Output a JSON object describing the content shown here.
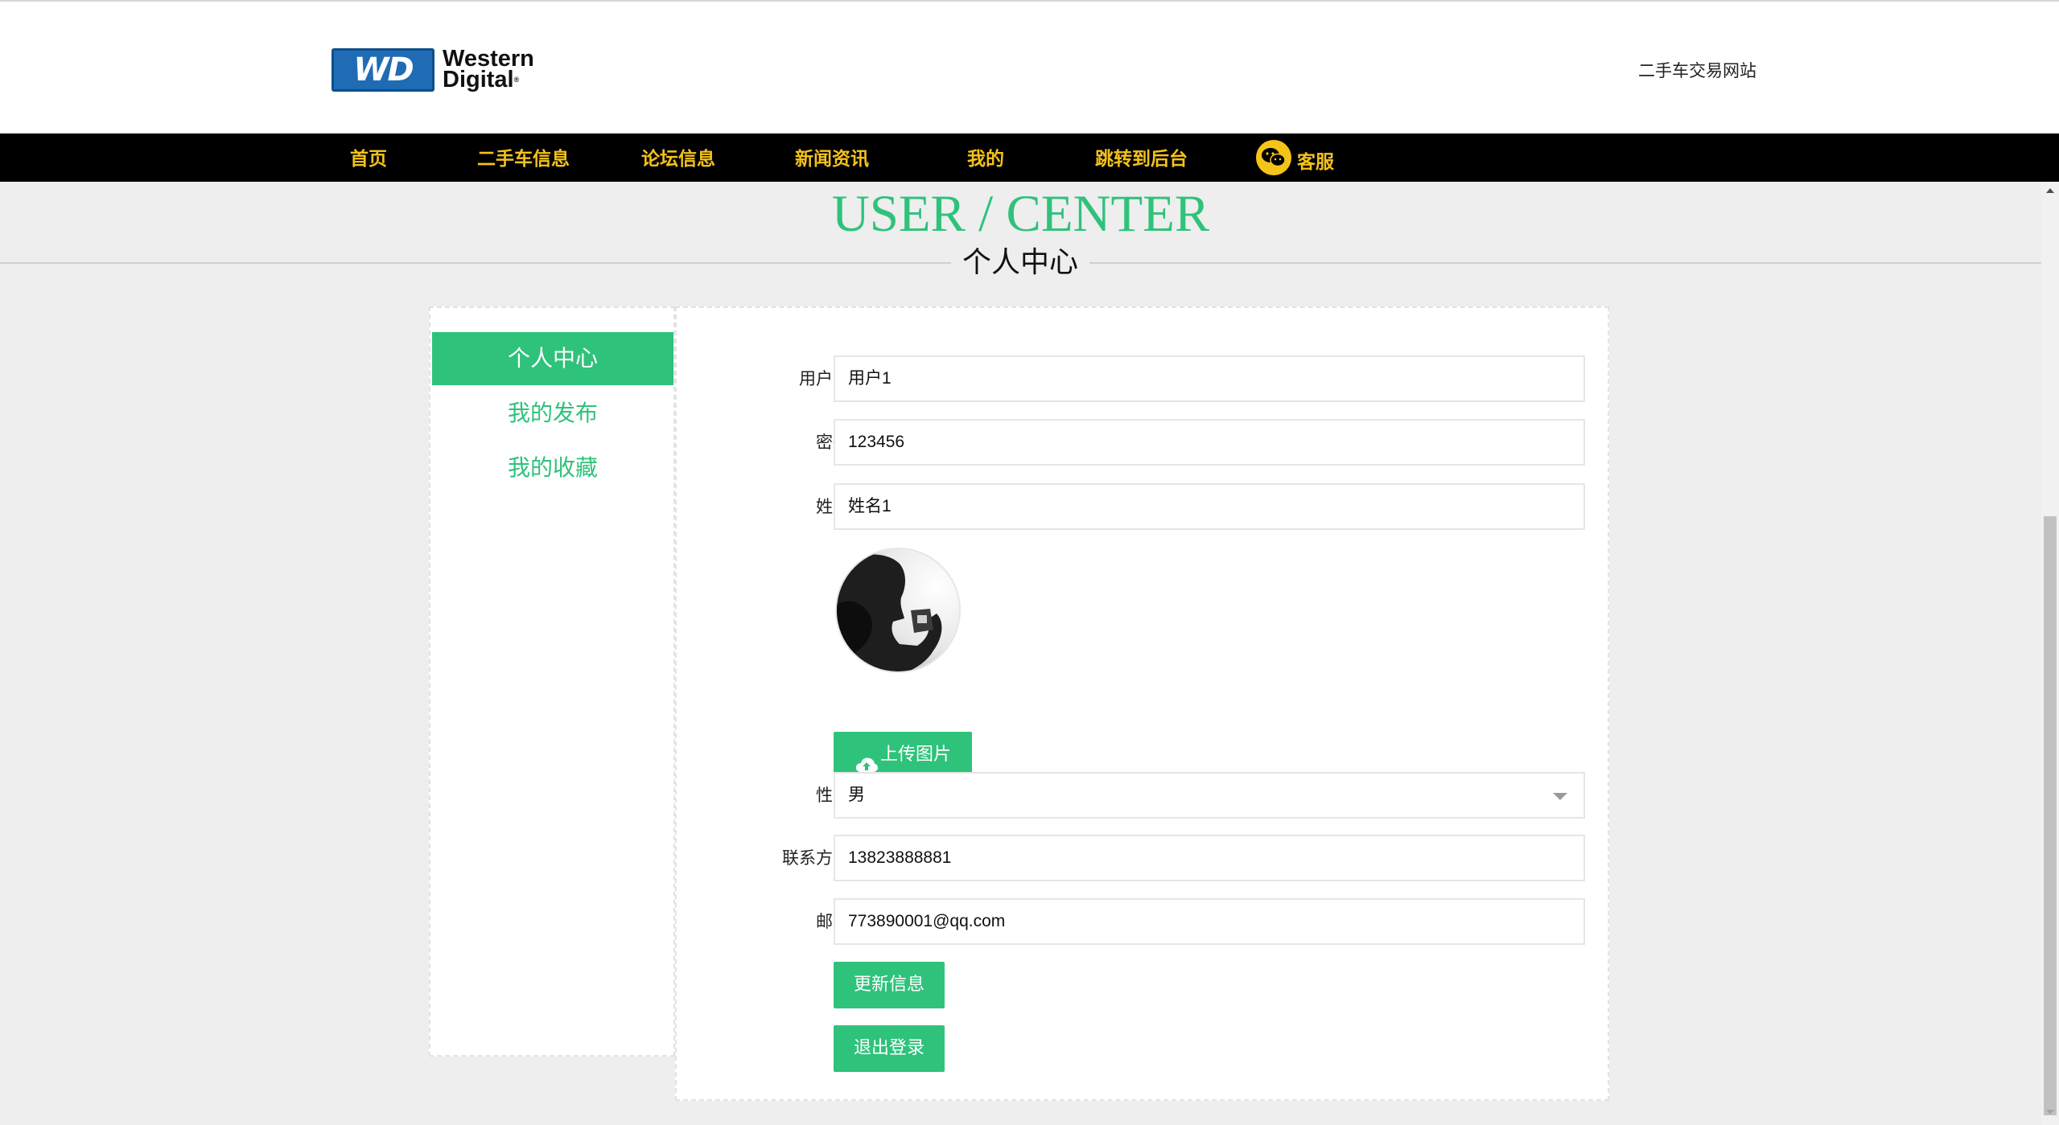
{
  "header": {
    "logo_mark": "WD",
    "logo_line1": "Western",
    "logo_line2": "Digital",
    "site_title": "二手车交易网站"
  },
  "nav": {
    "items": [
      {
        "label": "首页"
      },
      {
        "label": "二手车信息"
      },
      {
        "label": "论坛信息"
      },
      {
        "label": "新闻资讯"
      },
      {
        "label": "我的"
      },
      {
        "label": "跳转到后台"
      },
      {
        "label": "客服"
      }
    ]
  },
  "page": {
    "title_en": "USER / CENTER",
    "title_cn": "个人中心"
  },
  "sidebar": {
    "items": [
      {
        "label": "个人中心",
        "active": true
      },
      {
        "label": "我的发布"
      },
      {
        "label": "我的收藏"
      }
    ]
  },
  "form": {
    "username": {
      "label": "用户名",
      "value": "用户1"
    },
    "password": {
      "label": "密码",
      "value": "123456"
    },
    "name": {
      "label": "姓名",
      "value": "姓名1"
    },
    "upload_label": "上传图片",
    "gender": {
      "label": "性别",
      "value": "男"
    },
    "phone": {
      "label": "联系方式",
      "value": "13823888881"
    },
    "email": {
      "label": "邮箱",
      "value": "773890001@qq.com"
    },
    "update_label": "更新信息",
    "logout_label": "退出登录"
  },
  "colors": {
    "accent": "#2fc27b",
    "nav_bg": "#000000",
    "nav_text": "#f4c21b",
    "logo_blue": "#1f6cb5"
  },
  "icons": {
    "wechat": "wechat-icon",
    "upload": "cloud-upload-icon",
    "dropdown": "chevron-down-icon"
  }
}
